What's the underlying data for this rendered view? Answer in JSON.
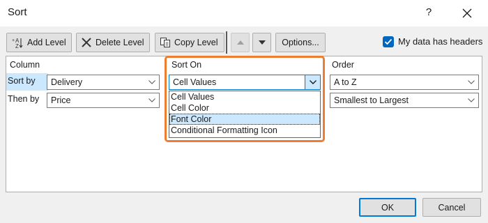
{
  "dialog": {
    "title": "Sort",
    "help_label": "?"
  },
  "toolbar": {
    "add_level": "Add Level",
    "delete_level": "Delete Level",
    "copy_level": "Copy Level",
    "options": "Options...",
    "headers_checkbox_label": "My data has headers",
    "headers_checked": true
  },
  "grid": {
    "columns": [
      "Column",
      "Sort On",
      "Order"
    ],
    "rows": [
      {
        "label": "Sort by",
        "column": "Delivery",
        "sort_on": "Cell Values",
        "order": "A to Z"
      },
      {
        "label": "Then by",
        "column": "Price",
        "sort_on": "",
        "order": "Smallest to Largest"
      }
    ]
  },
  "sort_on_dropdown": {
    "options": [
      "Cell Values",
      "Cell Color",
      "Font Color",
      "Conditional Formatting Icon"
    ],
    "selected_index": 2
  },
  "footer": {
    "ok": "OK",
    "cancel": "Cancel"
  },
  "colors": {
    "highlight": "#ed7d31",
    "accent": "#0078d7",
    "selection": "#cce8ff"
  }
}
